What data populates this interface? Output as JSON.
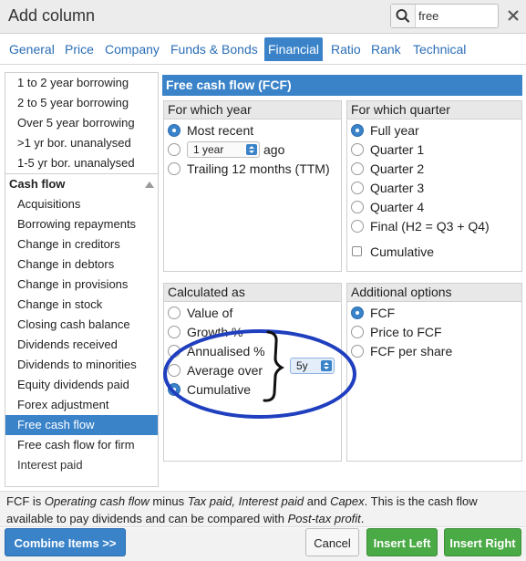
{
  "dialog": {
    "title": "Add column",
    "close_icon": "close-icon"
  },
  "search": {
    "value": "free",
    "icon": "search-icon"
  },
  "tabs": [
    {
      "label": "General"
    },
    {
      "label": "Price"
    },
    {
      "label": "Company"
    },
    {
      "label": "Funds & Bonds"
    },
    {
      "label": "Financial",
      "active": true
    },
    {
      "label": "Ratio"
    },
    {
      "label": "Rank"
    },
    {
      "label": "Technical"
    }
  ],
  "sidebar": {
    "top_items": [
      {
        "label": "1 to 2 year borrowing"
      },
      {
        "label": "2 to 5 year borrowing"
      },
      {
        "label": "Over 5 year borrowing"
      },
      {
        "label": ">1 yr bor. unanalysed"
      },
      {
        "label": "1-5 yr bor. unanalysed"
      }
    ],
    "section_header": "Cash flow",
    "section_icon": "collapse-up-icon",
    "items": [
      {
        "label": "Acquisitions"
      },
      {
        "label": "Borrowing repayments"
      },
      {
        "label": "Change in creditors"
      },
      {
        "label": "Change in debtors"
      },
      {
        "label": "Change in provisions"
      },
      {
        "label": "Change in stock"
      },
      {
        "label": "Closing cash balance"
      },
      {
        "label": "Dividends received"
      },
      {
        "label": "Dividends to minorities"
      },
      {
        "label": "Equity dividends paid"
      },
      {
        "label": "Forex adjustment"
      },
      {
        "label": "Free cash flow",
        "selected": true
      },
      {
        "label": "Free cash flow for firm"
      },
      {
        "label": "Interest paid"
      }
    ]
  },
  "content": {
    "header": "Free cash flow (FCF)",
    "year_panel": {
      "title": "For which year",
      "most_recent": "Most recent",
      "year_select": "1 year",
      "ago": "ago",
      "ttm": "Trailing 12 months (TTM)"
    },
    "quarter_panel": {
      "title": "For which quarter",
      "options": [
        {
          "label": "Full year",
          "checked": true
        },
        {
          "label": "Quarter 1"
        },
        {
          "label": "Quarter 2"
        },
        {
          "label": "Quarter 3"
        },
        {
          "label": "Quarter 4"
        },
        {
          "label": "Final (H2 = Q3 + Q4)"
        }
      ],
      "cumulative": "Cumulative"
    },
    "calc_panel": {
      "title": "Calculated as",
      "options": [
        {
          "label": "Value of"
        },
        {
          "label": "Growth %"
        },
        {
          "label": "Annualised %"
        },
        {
          "label": "Average over"
        },
        {
          "label": "Cumulative",
          "checked": true
        }
      ],
      "period_select": "5y"
    },
    "additional_panel": {
      "title": "Additional options",
      "options": [
        {
          "label": "FCF",
          "checked": true
        },
        {
          "label": "Price to FCF"
        },
        {
          "label": "FCF per share"
        }
      ]
    }
  },
  "description": {
    "p1": "FCF is ",
    "i1": "Operating cash flow",
    "p2": " minus ",
    "i2": "Tax paid, Interest paid",
    "p3": " and ",
    "i3": "Capex",
    "p4": ". This is the cash flow available to pay dividends and can be compared with ",
    "i4": "Post-tax profit",
    "p5": "."
  },
  "footer": {
    "combine": "Combine Items >>",
    "cancel": "Cancel",
    "insert_left": "Insert Left",
    "insert_right": "Insert Right"
  },
  "colors": {
    "accent": "#3a83c9",
    "green": "#4aaa45",
    "annotation": "#1f3fbf"
  }
}
